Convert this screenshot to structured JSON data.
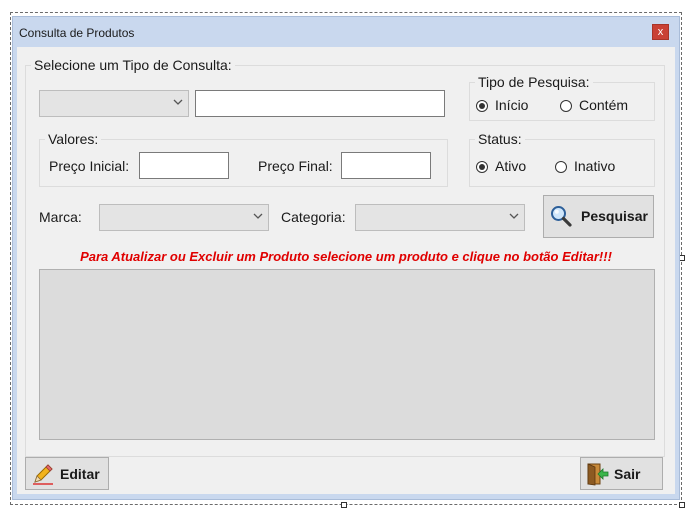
{
  "window": {
    "title": "Consulta de Produtos",
    "close_glyph": "x"
  },
  "consulta": {
    "group_label": "Selecione um Tipo de Consulta:",
    "tipo_selected": "",
    "search_value": ""
  },
  "tipo_pesquisa": {
    "label": "Tipo de Pesquisa:",
    "options": [
      {
        "label": "Início",
        "checked": true
      },
      {
        "label": "Contém",
        "checked": false
      }
    ]
  },
  "valores": {
    "label": "Valores:",
    "preco_inicial_label": "Preço Inicial:",
    "preco_inicial_value": "",
    "preco_final_label": "Preço Final:",
    "preco_final_value": ""
  },
  "status": {
    "label": "Status:",
    "options": [
      {
        "label": "Ativo",
        "checked": true
      },
      {
        "label": "Inativo",
        "checked": false
      }
    ]
  },
  "filters": {
    "marca_label": "Marca:",
    "marca_selected": "",
    "categoria_label": "Categoria:",
    "categoria_selected": ""
  },
  "buttons": {
    "pesquisar": "Pesquisar",
    "editar": "Editar",
    "sair": "Sair"
  },
  "notice": "Para Atualizar ou Excluir um Produto selecione um produto e clique no botão Editar!!!",
  "icons": {
    "pesquisar": "magnifier-icon",
    "editar": "pencil-icon",
    "sair": "exit-door-icon",
    "dropdown": "chevron-down-icon"
  },
  "colors": {
    "notice": "#e00000",
    "titlebar": "#c9d8ee",
    "close": "#c94135"
  }
}
